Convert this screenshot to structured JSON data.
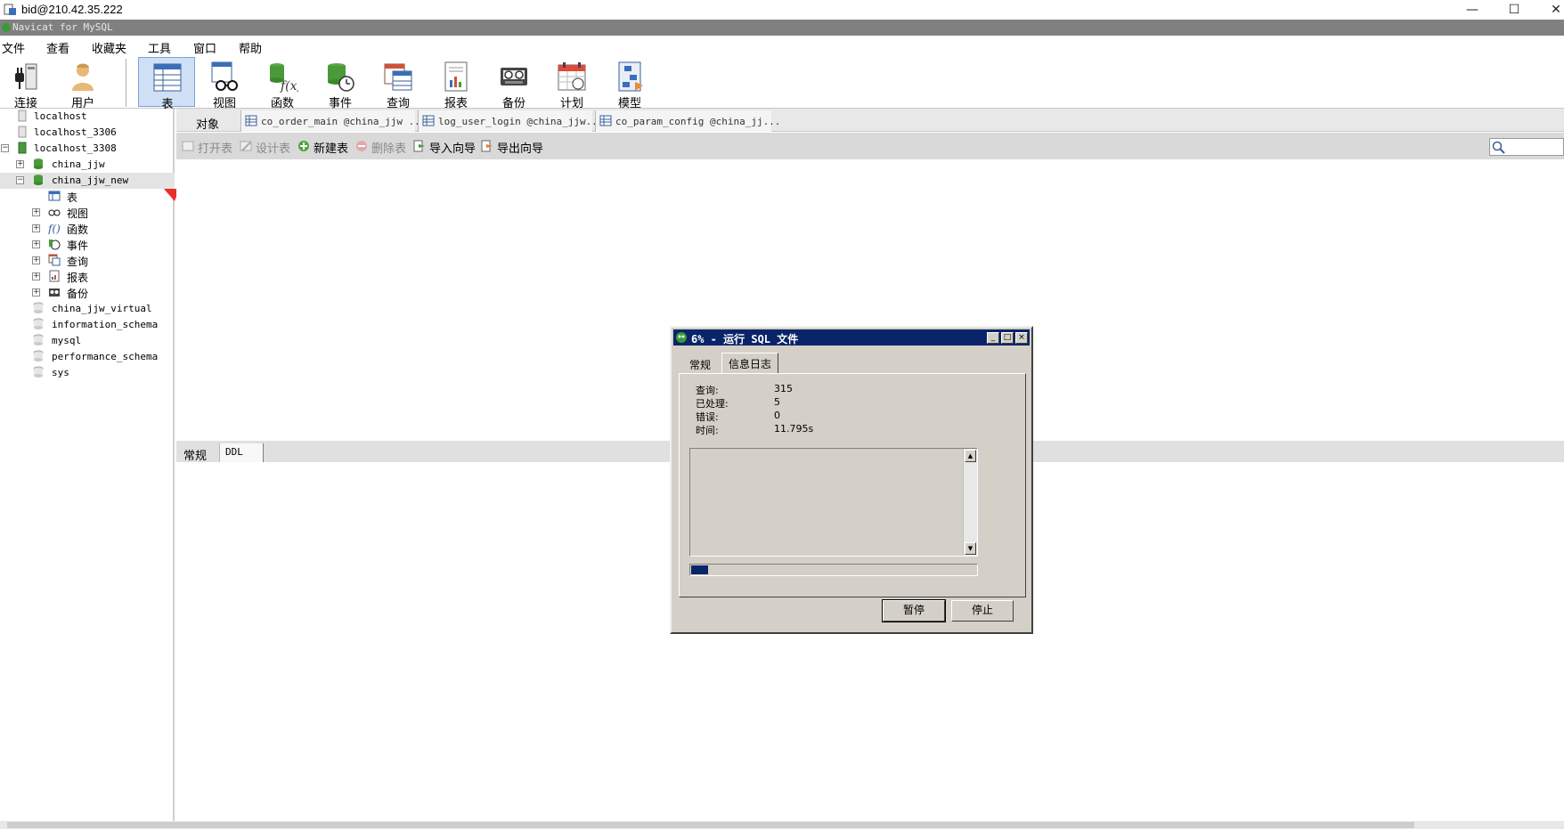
{
  "window": {
    "title": "bid@210.42.35.222",
    "minimize_glyph": "—",
    "maximize_glyph": "☐",
    "close_glyph": "✕"
  },
  "app_caption": "Navicat for MySQL",
  "menu": [
    "文件",
    "查看",
    "收藏夹",
    "工具",
    "窗口",
    "帮助"
  ],
  "toolbar": {
    "connect": "连接",
    "user": "用户",
    "table": "表",
    "view": "视图",
    "function": "函数",
    "event": "事件",
    "query": "查询",
    "report": "报表",
    "backup": "备份",
    "schedule": "计划",
    "model": "模型"
  },
  "tree": {
    "connections": [
      "localhost",
      "localhost_3306",
      "localhost_3308"
    ],
    "databases": [
      "china_jjw",
      "china_jjw_new"
    ],
    "objects": [
      "表",
      "视图",
      "函数",
      "事件",
      "查询",
      "报表",
      "备份"
    ],
    "other_databases": [
      "china_jjw_virtual",
      "information_schema",
      "mysql",
      "performance_schema",
      "sys"
    ]
  },
  "tabs": {
    "objects": "对象",
    "open": [
      "co_order_main @china_jjw ...",
      "log_user_login @china_jjw...",
      "co_param_config @china_jj..."
    ]
  },
  "object_toolbar": {
    "open_table": "打开表",
    "design_table": "设计表",
    "new_table": "新建表",
    "delete_table": "删除表",
    "import_wizard": "导入向导",
    "export_wizard": "导出向导"
  },
  "info_tabs": [
    "常规",
    "DDL"
  ],
  "dialog": {
    "title": "6% - 运行 SQL 文件",
    "tabs": [
      "常规",
      "信息日志"
    ],
    "queries_label": "查询:",
    "queries_value": "315",
    "processed_label": "已处理:",
    "processed_value": "5",
    "errors_label": "错误:",
    "errors_value": "0",
    "time_label": "时间:",
    "time_value": "11.795s",
    "progress_fraction": 0.06,
    "pause_button": "暂停",
    "stop_button": "停止",
    "min_glyph": "_",
    "max_glyph": "□",
    "close_glyph": "×"
  },
  "icons": [
    "app-icon",
    "connect-icon",
    "user-icon",
    "table-icon",
    "view-icon",
    "function-icon",
    "event-icon",
    "query-icon",
    "report-icon",
    "backup-icon",
    "schedule-icon",
    "model-icon",
    "search-icon",
    "red-arrow-annotation"
  ],
  "colors": {
    "accent_selection": "#cfe0f5",
    "dialog_title": "#0a246a",
    "db_green": "#3a9a3a",
    "annotation_red": "#e8302a"
  }
}
